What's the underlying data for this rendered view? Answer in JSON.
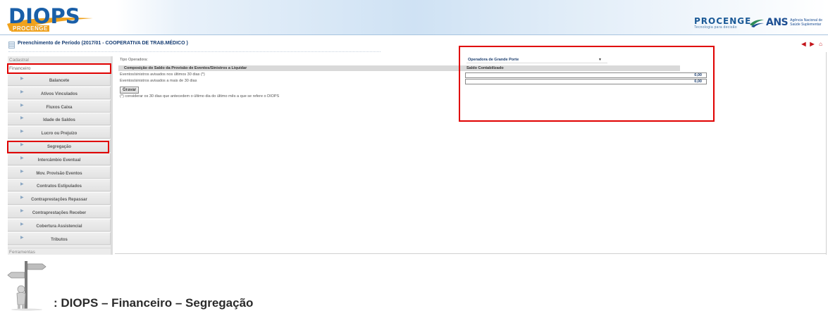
{
  "header": {
    "logo_text": "DIOPS",
    "logo_sub": "PROCENGE",
    "procenge_name": "PROCENGE",
    "procenge_tag": "Tecnologia para decisão",
    "ans_name": "ANS",
    "ans_desc": "Agência Nacional de Saúde Suplementar"
  },
  "titlebar": {
    "title": "Preenchimento de Período (2017/01 - COOPERATIVA DE TRAB.MÉDICO )"
  },
  "sidebar": {
    "sections": {
      "cadastral": "Cadastral",
      "financeiro": "Financeiro",
      "ferramentas": "Ferramentas"
    },
    "items": [
      {
        "label": "Balancete"
      },
      {
        "label": "Ativos Vinculados"
      },
      {
        "label": "Fluxos Caixa"
      },
      {
        "label": "Idade de Saldos"
      },
      {
        "label": "Lucro ou Prejuízo"
      },
      {
        "label": "Segregação"
      },
      {
        "label": "Intercâmbio Eventual"
      },
      {
        "label": "Mov. Provisão Eventos"
      },
      {
        "label": "Contratos Estipulados"
      },
      {
        "label": "Contraprestações Repassar"
      },
      {
        "label": "Contraprestações Receber"
      },
      {
        "label": "Cobertura Assistencial"
      },
      {
        "label": "Tributos"
      }
    ]
  },
  "form": {
    "tipo_label": "Tipo Operadora:",
    "tipo_value": "Operadora de Grande Porte",
    "table_head_left": "Composição do Saldo da Provisão de Eventos/Sinistros a Liquidar",
    "table_head_right": "Saldo Contabilizado",
    "row1_label": "Eventos/sinistros avisados nos últimos 30 dias (*)",
    "row1_value": "0,00",
    "row2_label": "Eventos/sinistros avisados a mais de 30 dias",
    "row2_value": "0,00",
    "gravar_label": "Gravar",
    "note": "(*) considerar os 30 dias que antecedem o último dia do último mês a que se refere o DIOPS"
  },
  "caption": ": DIOPS – Financeiro – Segregação",
  "colors": {
    "highlight": "#e00000",
    "title_blue": "#163d73",
    "logo_blue": "#1a5fa8",
    "logo_orange": "#f0a21d"
  }
}
